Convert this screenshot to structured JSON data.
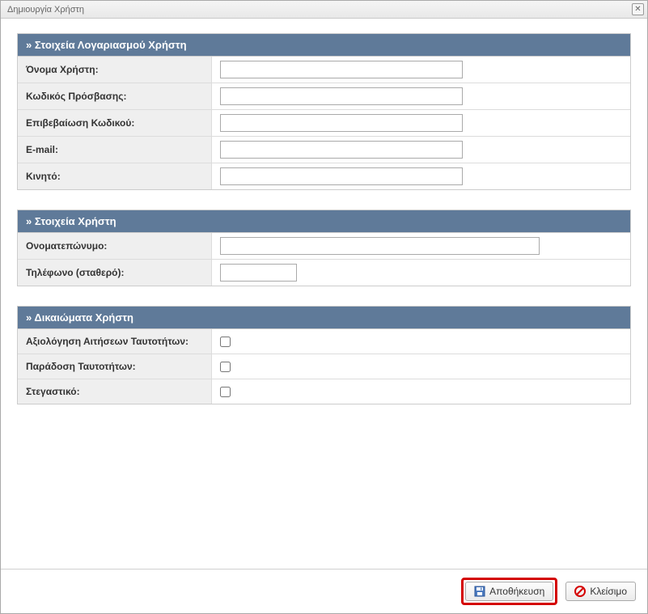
{
  "window": {
    "title": "Δημιουργία Χρήστη"
  },
  "sections": {
    "account": {
      "header": "»  Στοιχεία Λογαριασμού Χρήστη",
      "username_label": "Όνομα Χρήστη:",
      "password_label": "Κωδικός Πρόσβασης:",
      "confirm_label": "Επιβεβαίωση Κωδικού:",
      "email_label": "E-mail:",
      "mobile_label": "Κινητό:"
    },
    "user": {
      "header": "»  Στοιχεία Χρήστη",
      "fullname_label": "Ονοματεπώνυμο:",
      "phone_label": "Τηλέφωνο (σταθερό):"
    },
    "rights": {
      "header": "»  Δικαιώματα Χρήστη",
      "eval_label": "Αξιολόγηση Αιτήσεων Ταυτοτήτων:",
      "delivery_label": "Παράδοση Ταυτοτήτων:",
      "housing_label": "Στεγαστικό:"
    }
  },
  "footer": {
    "save_label": "Αποθήκευση",
    "close_label": "Κλείσιμο"
  },
  "values": {
    "username": "",
    "password": "",
    "confirm": "",
    "email": "",
    "mobile": "",
    "fullname": "",
    "phone": ""
  }
}
